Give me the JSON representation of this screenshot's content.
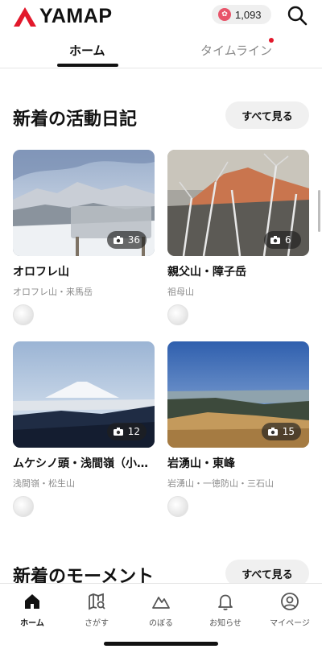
{
  "app": {
    "logo_text": "YAMAP",
    "brand_color": "#e2182b"
  },
  "header": {
    "points_value": "1,093",
    "points_icon": "yamap-point-icon",
    "search_icon": "search-icon"
  },
  "tabs": [
    {
      "label": "ホーム",
      "active": true
    },
    {
      "label": "タイムライン",
      "active": false,
      "has_notification": true
    }
  ],
  "activity_section": {
    "title": "新着の活動日記",
    "see_all_label": "すべて見る",
    "cards": [
      {
        "title": "オロフレ山",
        "mountains": "オロフレ山・来馬岳",
        "photo_count": "36"
      },
      {
        "title": "親父山・障子岳",
        "mountains": "祖母山",
        "photo_count": "6"
      },
      {
        "title": "ムケシノ頭・浅間嶺（小…",
        "mountains": "浅間嶺・松生山",
        "photo_count": "12"
      },
      {
        "title": "岩湧山・東峰",
        "mountains": "岩湧山・一徳防山・三石山",
        "photo_count": "15"
      }
    ]
  },
  "moment_section": {
    "title": "新着のモーメント",
    "see_all_label": "すべて見る"
  },
  "bottom_nav": [
    {
      "label": "ホーム",
      "icon": "home-icon",
      "active": true
    },
    {
      "label": "さがす",
      "icon": "map-search-icon",
      "active": false
    },
    {
      "label": "のぼる",
      "icon": "mountain-icon",
      "active": false
    },
    {
      "label": "お知らせ",
      "icon": "bell-icon",
      "active": false
    },
    {
      "label": "マイページ",
      "icon": "user-icon",
      "active": false
    }
  ]
}
